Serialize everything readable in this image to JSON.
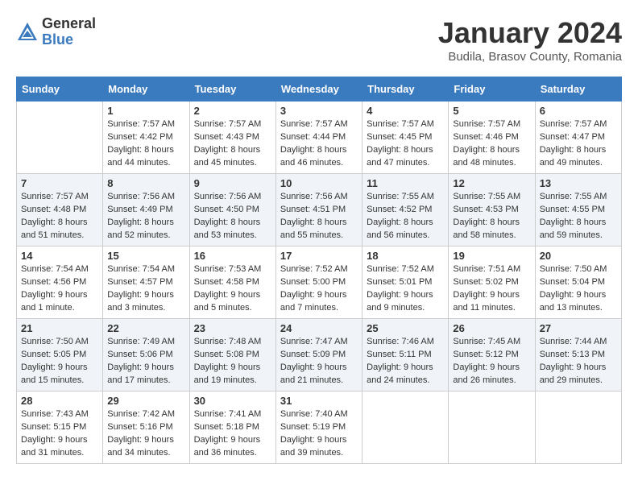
{
  "logo": {
    "general": "General",
    "blue": "Blue"
  },
  "title": "January 2024",
  "location": "Budila, Brasov County, Romania",
  "weekdays": [
    "Sunday",
    "Monday",
    "Tuesday",
    "Wednesday",
    "Thursday",
    "Friday",
    "Saturday"
  ],
  "weeks": [
    [
      {
        "day": "",
        "sunrise": "",
        "sunset": "",
        "daylight": ""
      },
      {
        "day": "1",
        "sunrise": "Sunrise: 7:57 AM",
        "sunset": "Sunset: 4:42 PM",
        "daylight": "Daylight: 8 hours and 44 minutes."
      },
      {
        "day": "2",
        "sunrise": "Sunrise: 7:57 AM",
        "sunset": "Sunset: 4:43 PM",
        "daylight": "Daylight: 8 hours and 45 minutes."
      },
      {
        "day": "3",
        "sunrise": "Sunrise: 7:57 AM",
        "sunset": "Sunset: 4:44 PM",
        "daylight": "Daylight: 8 hours and 46 minutes."
      },
      {
        "day": "4",
        "sunrise": "Sunrise: 7:57 AM",
        "sunset": "Sunset: 4:45 PM",
        "daylight": "Daylight: 8 hours and 47 minutes."
      },
      {
        "day": "5",
        "sunrise": "Sunrise: 7:57 AM",
        "sunset": "Sunset: 4:46 PM",
        "daylight": "Daylight: 8 hours and 48 minutes."
      },
      {
        "day": "6",
        "sunrise": "Sunrise: 7:57 AM",
        "sunset": "Sunset: 4:47 PM",
        "daylight": "Daylight: 8 hours and 49 minutes."
      }
    ],
    [
      {
        "day": "7",
        "sunrise": "Sunrise: 7:57 AM",
        "sunset": "Sunset: 4:48 PM",
        "daylight": "Daylight: 8 hours and 51 minutes."
      },
      {
        "day": "8",
        "sunrise": "Sunrise: 7:56 AM",
        "sunset": "Sunset: 4:49 PM",
        "daylight": "Daylight: 8 hours and 52 minutes."
      },
      {
        "day": "9",
        "sunrise": "Sunrise: 7:56 AM",
        "sunset": "Sunset: 4:50 PM",
        "daylight": "Daylight: 8 hours and 53 minutes."
      },
      {
        "day": "10",
        "sunrise": "Sunrise: 7:56 AM",
        "sunset": "Sunset: 4:51 PM",
        "daylight": "Daylight: 8 hours and 55 minutes."
      },
      {
        "day": "11",
        "sunrise": "Sunrise: 7:55 AM",
        "sunset": "Sunset: 4:52 PM",
        "daylight": "Daylight: 8 hours and 56 minutes."
      },
      {
        "day": "12",
        "sunrise": "Sunrise: 7:55 AM",
        "sunset": "Sunset: 4:53 PM",
        "daylight": "Daylight: 8 hours and 58 minutes."
      },
      {
        "day": "13",
        "sunrise": "Sunrise: 7:55 AM",
        "sunset": "Sunset: 4:55 PM",
        "daylight": "Daylight: 8 hours and 59 minutes."
      }
    ],
    [
      {
        "day": "14",
        "sunrise": "Sunrise: 7:54 AM",
        "sunset": "Sunset: 4:56 PM",
        "daylight": "Daylight: 9 hours and 1 minute."
      },
      {
        "day": "15",
        "sunrise": "Sunrise: 7:54 AM",
        "sunset": "Sunset: 4:57 PM",
        "daylight": "Daylight: 9 hours and 3 minutes."
      },
      {
        "day": "16",
        "sunrise": "Sunrise: 7:53 AM",
        "sunset": "Sunset: 4:58 PM",
        "daylight": "Daylight: 9 hours and 5 minutes."
      },
      {
        "day": "17",
        "sunrise": "Sunrise: 7:52 AM",
        "sunset": "Sunset: 5:00 PM",
        "daylight": "Daylight: 9 hours and 7 minutes."
      },
      {
        "day": "18",
        "sunrise": "Sunrise: 7:52 AM",
        "sunset": "Sunset: 5:01 PM",
        "daylight": "Daylight: 9 hours and 9 minutes."
      },
      {
        "day": "19",
        "sunrise": "Sunrise: 7:51 AM",
        "sunset": "Sunset: 5:02 PM",
        "daylight": "Daylight: 9 hours and 11 minutes."
      },
      {
        "day": "20",
        "sunrise": "Sunrise: 7:50 AM",
        "sunset": "Sunset: 5:04 PM",
        "daylight": "Daylight: 9 hours and 13 minutes."
      }
    ],
    [
      {
        "day": "21",
        "sunrise": "Sunrise: 7:50 AM",
        "sunset": "Sunset: 5:05 PM",
        "daylight": "Daylight: 9 hours and 15 minutes."
      },
      {
        "day": "22",
        "sunrise": "Sunrise: 7:49 AM",
        "sunset": "Sunset: 5:06 PM",
        "daylight": "Daylight: 9 hours and 17 minutes."
      },
      {
        "day": "23",
        "sunrise": "Sunrise: 7:48 AM",
        "sunset": "Sunset: 5:08 PM",
        "daylight": "Daylight: 9 hours and 19 minutes."
      },
      {
        "day": "24",
        "sunrise": "Sunrise: 7:47 AM",
        "sunset": "Sunset: 5:09 PM",
        "daylight": "Daylight: 9 hours and 21 minutes."
      },
      {
        "day": "25",
        "sunrise": "Sunrise: 7:46 AM",
        "sunset": "Sunset: 5:11 PM",
        "daylight": "Daylight: 9 hours and 24 minutes."
      },
      {
        "day": "26",
        "sunrise": "Sunrise: 7:45 AM",
        "sunset": "Sunset: 5:12 PM",
        "daylight": "Daylight: 9 hours and 26 minutes."
      },
      {
        "day": "27",
        "sunrise": "Sunrise: 7:44 AM",
        "sunset": "Sunset: 5:13 PM",
        "daylight": "Daylight: 9 hours and 29 minutes."
      }
    ],
    [
      {
        "day": "28",
        "sunrise": "Sunrise: 7:43 AM",
        "sunset": "Sunset: 5:15 PM",
        "daylight": "Daylight: 9 hours and 31 minutes."
      },
      {
        "day": "29",
        "sunrise": "Sunrise: 7:42 AM",
        "sunset": "Sunset: 5:16 PM",
        "daylight": "Daylight: 9 hours and 34 minutes."
      },
      {
        "day": "30",
        "sunrise": "Sunrise: 7:41 AM",
        "sunset": "Sunset: 5:18 PM",
        "daylight": "Daylight: 9 hours and 36 minutes."
      },
      {
        "day": "31",
        "sunrise": "Sunrise: 7:40 AM",
        "sunset": "Sunset: 5:19 PM",
        "daylight": "Daylight: 9 hours and 39 minutes."
      },
      {
        "day": "",
        "sunrise": "",
        "sunset": "",
        "daylight": ""
      },
      {
        "day": "",
        "sunrise": "",
        "sunset": "",
        "daylight": ""
      },
      {
        "day": "",
        "sunrise": "",
        "sunset": "",
        "daylight": ""
      }
    ]
  ]
}
